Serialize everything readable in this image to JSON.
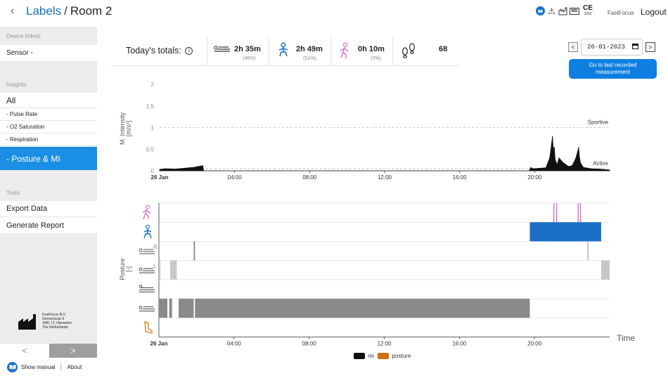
{
  "header": {
    "back_icon": "chevron-left",
    "breadcrumb_link": "Labels",
    "breadcrumb_sep": "/",
    "breadcrumb_current": "Room 2",
    "brand": "FastFocus",
    "logout": "Logout",
    "ce_year": "1912",
    "md": "MD"
  },
  "sidebar": {
    "device_title": "Device linked:",
    "device": "Sensor -",
    "insights_title": "Insights:",
    "all": "All",
    "items": [
      "-   Pulse Rate",
      "-   O2 Saturation",
      "-   Respiration"
    ],
    "active": "-   Posture & MI",
    "tools_title": "Tools:",
    "tools": [
      "Export Data",
      "Generate Report"
    ],
    "company": [
      "FastFocus B.V.",
      "Genverscop 9",
      "3481 LT, Harmelen",
      "The Netherlands"
    ],
    "prev": "<",
    "next": ">",
    "manual": "Show manual",
    "about": "About"
  },
  "totals": {
    "label": "Today's totals:",
    "info_icon": "i",
    "items": [
      {
        "icon": "lying-icon",
        "value": "2h 35m",
        "pct": "(46%)"
      },
      {
        "icon": "sitting-icon",
        "value": "2h 49m",
        "pct": "(51%)"
      },
      {
        "icon": "walking-icon",
        "value": "0h 10m",
        "pct": "(3%)"
      },
      {
        "icon": "footsteps-icon",
        "value": "68"
      }
    ]
  },
  "date": {
    "value": "26-01-2023",
    "prev": "<",
    "next": ">",
    "goto": [
      "Go to last recorded",
      "measurement"
    ]
  },
  "colors": {
    "accent": "#1a8fe3",
    "sitting": "#1a6fc4",
    "walking": "#d774d6",
    "gray": "#888888",
    "orange": "#d86b00"
  },
  "chart_data": [
    {
      "type": "area",
      "ylabel": "M. Intensity [m/s²]",
      "ylim": [
        0,
        2
      ],
      "yticks": [
        "0",
        "0.5",
        "1",
        "1.5",
        "2"
      ],
      "x_range_hours": [
        0,
        24
      ],
      "xticks": [
        "26 Jan",
        "04:00",
        "08:00",
        "12:00",
        "16:00",
        "20:00"
      ],
      "thresholds": [
        {
          "label": "Sportive",
          "value": 1.0
        },
        {
          "label": "Active",
          "value": 0.05
        }
      ],
      "series": [
        {
          "name": "mi",
          "x": [
            0,
            0.3,
            0.8,
            1.3,
            1.8,
            2.3,
            2.35,
            19.7,
            19.8,
            19.9,
            20.6,
            20.8,
            20.95,
            21.0,
            21.05,
            21.1,
            21.2,
            21.3,
            21.5,
            21.8,
            22.0,
            22.2,
            22.35,
            22.4,
            22.45,
            22.6,
            23.0,
            23.5,
            24
          ],
          "values": [
            0.03,
            0.05,
            0.04,
            0.06,
            0.08,
            0.12,
            0.0,
            0.0,
            0.08,
            0.05,
            0.07,
            0.3,
            0.8,
            0.5,
            0.55,
            0.25,
            0.15,
            0.3,
            0.2,
            0.1,
            0.12,
            0.3,
            0.55,
            0.3,
            0.18,
            0.08,
            0.05,
            0.04,
            0.02
          ]
        }
      ]
    },
    {
      "type": "timeline",
      "ylabel": "Posture [-]",
      "xlabel": "Time",
      "x_range_hours": [
        0,
        24
      ],
      "xticks": [
        "26 Jan",
        "04:00",
        "08:00",
        "12:00",
        "16:00",
        "20:00"
      ],
      "rows": [
        {
          "name": "walking",
          "icon": "walking-icon",
          "letter": ""
        },
        {
          "name": "sitting",
          "icon": "sitting-icon",
          "letter": ""
        },
        {
          "name": "lying right",
          "icon": "lying-icon",
          "letter": "R"
        },
        {
          "name": "lying left",
          "icon": "lying-icon",
          "letter": "L"
        },
        {
          "name": "lying prone",
          "icon": "lying-prone-icon",
          "letter": ""
        },
        {
          "name": "lying back",
          "icon": "lying-icon",
          "letter": ""
        },
        {
          "name": "unknown",
          "icon": "foot-icon",
          "letter": ""
        }
      ],
      "segments": [
        {
          "row": 0,
          "start": 21.0,
          "end": 21.05,
          "color": "walking"
        },
        {
          "row": 0,
          "start": 21.15,
          "end": 21.2,
          "color": "walking"
        },
        {
          "row": 0,
          "start": 22.3,
          "end": 22.35,
          "color": "walking"
        },
        {
          "row": 0,
          "start": 22.42,
          "end": 22.47,
          "color": "walking"
        },
        {
          "row": 1,
          "start": 19.75,
          "end": 23.55,
          "color": "sitting"
        },
        {
          "row": 2,
          "start": 1.85,
          "end": 1.92,
          "color": "gray"
        },
        {
          "row": 2,
          "start": 22.8,
          "end": 22.88,
          "color": "lightgray"
        },
        {
          "row": 3,
          "start": 0.0,
          "end": 0.08,
          "color": "lightgray"
        },
        {
          "row": 3,
          "start": 0.6,
          "end": 0.95,
          "color": "lightgray"
        },
        {
          "row": 3,
          "start": 23.55,
          "end": 24,
          "color": "lightgray"
        },
        {
          "row": 5,
          "start": 0.0,
          "end": 0.45,
          "color": "gray"
        },
        {
          "row": 5,
          "start": 0.55,
          "end": 0.7,
          "color": "gray"
        },
        {
          "row": 5,
          "start": 1.05,
          "end": 1.85,
          "color": "gray"
        },
        {
          "row": 5,
          "start": 1.92,
          "end": 19.75,
          "color": "gray"
        }
      ],
      "legend": [
        {
          "label": "mi",
          "color": "#111111"
        },
        {
          "label": "posture",
          "color": "#d07010"
        }
      ]
    }
  ]
}
